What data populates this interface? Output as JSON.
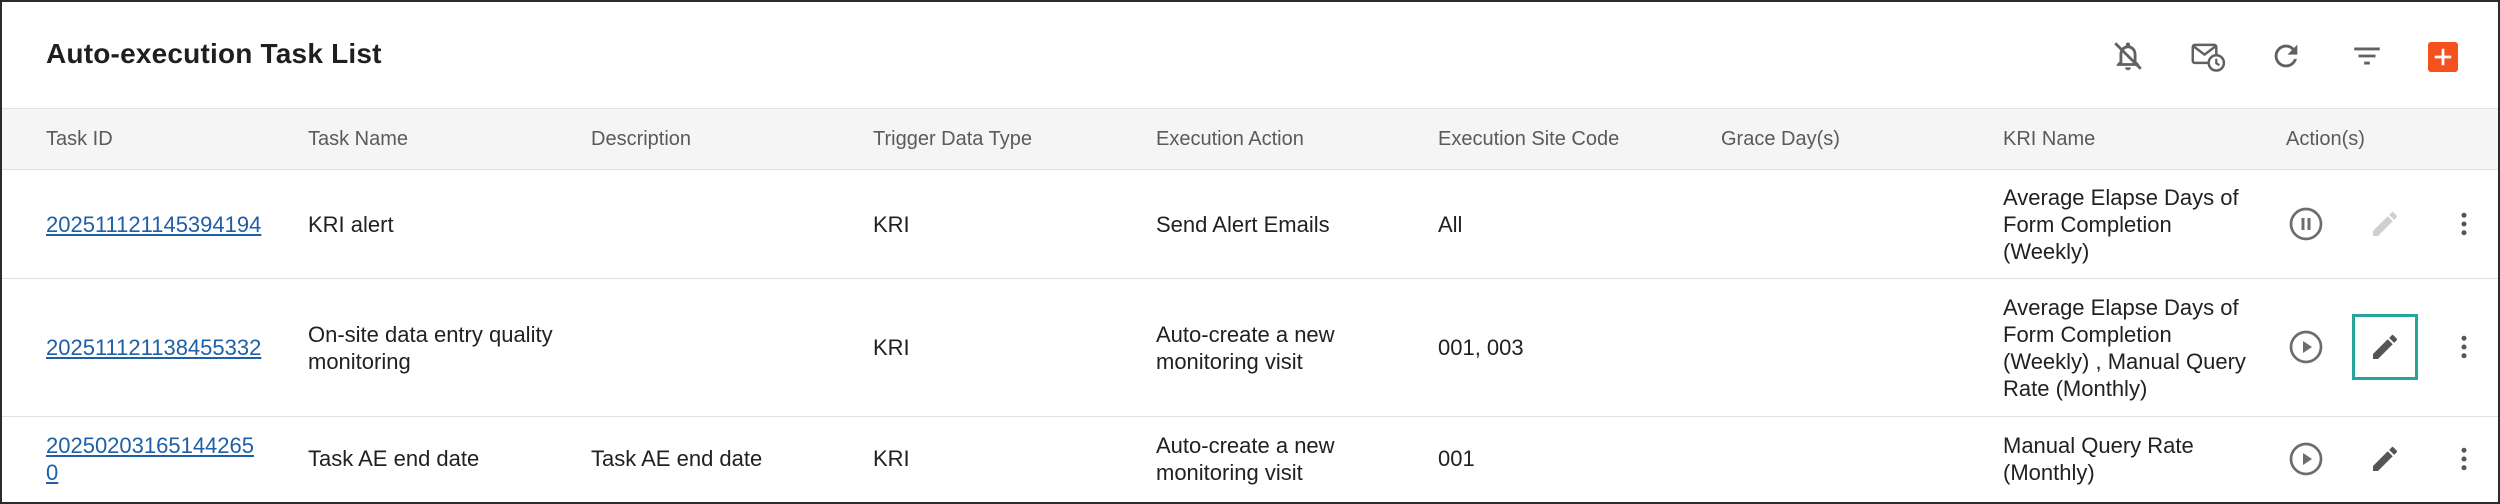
{
  "header": {
    "title": "Auto-execution Task List",
    "tools": [
      {
        "icon": "notifications-off-icon"
      },
      {
        "icon": "schedule-email-icon"
      },
      {
        "icon": "refresh-icon"
      },
      {
        "icon": "filter-icon"
      },
      {
        "icon": "add-icon"
      }
    ]
  },
  "table": {
    "columns": [
      "Task ID",
      "Task Name",
      "Description",
      "Trigger Data Type",
      "Execution Action",
      "Execution Site Code",
      "Grace Day(s)",
      "KRI Name",
      "Action(s)"
    ],
    "rows": [
      {
        "task_id": "202511121145394194",
        "task_name": "KRI alert",
        "description": "",
        "trigger_data_type": "KRI",
        "execution_action": "Send Alert Emails",
        "execution_site_code": "All",
        "grace_days": "",
        "kri_name": "Average Elapse Days of Form Completion (Weekly)",
        "state_icon": "pause-circle-icon",
        "edit_enabled": false
      },
      {
        "task_id": "202511121138455332",
        "task_name": "On-site data entry quality monitoring",
        "description": "",
        "trigger_data_type": "KRI",
        "execution_action": "Auto-create a new monitoring visit",
        "execution_site_code": "001, 003",
        "grace_days": "",
        "kri_name": "Average Elapse Days of Form Completion (Weekly) , Manual Query Rate (Monthly)",
        "state_icon": "play-circle-icon",
        "edit_enabled": true
      },
      {
        "task_id": "202502031651442650",
        "task_name": "Task AE end date",
        "description": "Task AE end date",
        "trigger_data_type": "KRI",
        "execution_action": "Auto-create a new monitoring visit",
        "execution_site_code": "001",
        "grace_days": "",
        "kri_name": "Manual Query Rate (Monthly)",
        "state_icon": "play-circle-icon",
        "edit_enabled": true
      }
    ]
  },
  "colors": {
    "link": "#1e5fa8",
    "accent_add": "#f4511e",
    "focus_outline": "#26a69a",
    "header_bg": "#f5f5f5",
    "icon_gray": "#757575",
    "icon_disabled": "#cfcfcf"
  }
}
